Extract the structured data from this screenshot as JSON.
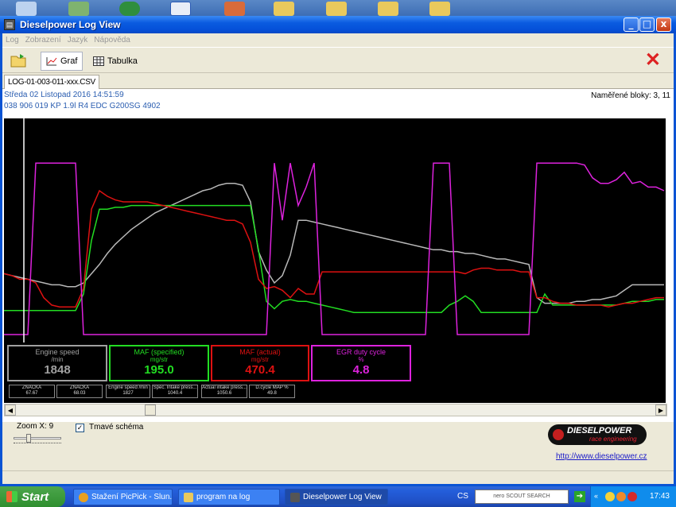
{
  "window": {
    "title": "Dieselpower Log View",
    "min": "_",
    "max": "□",
    "close": "x"
  },
  "menu": [
    "Log",
    "Zobrazení",
    "Jazyk",
    "Nápověda"
  ],
  "toolbar": {
    "graph_label": "Graf",
    "table_label": "Tabulka",
    "close_glyph": "✕"
  },
  "tab": {
    "file_name": "LOG-01-003-011-xxx.CSV"
  },
  "info": {
    "date": "Středa 02 Listopad 2016 14:51:59",
    "vehicle": "038 906 019 KP  1.9l R4 EDC G200SG  4902",
    "blocks": "Naměřené bloky: 3, 11"
  },
  "gauges": [
    {
      "label": "Engine speed",
      "unit": "/min",
      "value": "1848",
      "color": "#a0a0a0"
    },
    {
      "label": "MAF (specified)",
      "unit": "mg/str",
      "value": "195.0",
      "color": "#22dd22"
    },
    {
      "label": "MAF (actual)",
      "unit": "mg/str",
      "value": "470.4",
      "color": "#dd1111"
    },
    {
      "label": "EGR duty cycle",
      "unit": "%",
      "value": "4.8",
      "color": "#dd22dd"
    }
  ],
  "minis": [
    {
      "label": "ZNAČKA",
      "value": "67.67"
    },
    {
      "label": "ZNAČKA",
      "value": "68.03"
    },
    {
      "label": "Engine speed /min",
      "value": "1827"
    },
    {
      "label": "Spec. Intake press...",
      "value": "1040.4"
    },
    {
      "label": "Actual intake press...",
      "value": "1050.6"
    },
    {
      "label": "D.cycle MAP %",
      "value": "49.8"
    }
  ],
  "controls": {
    "zoom_label": "Zoom X: 9",
    "zoom_level": 9,
    "dark_scheme_label": "Tmavé schéma",
    "dark_scheme_checked": true,
    "dark_scheme_glyph": "✓"
  },
  "brand": {
    "name": "DIESELPOWER",
    "tagline": "race engineering",
    "url": "http://www.dieselpower.cz"
  },
  "taskbar": {
    "start": "Start",
    "tasks": [
      "Stažení PicPick - Slun...",
      "program na log",
      "Dieselpower Log View"
    ],
    "lang": "CS",
    "nero": "nero SCOUT SEARCH",
    "clock": "17:43"
  },
  "chart_data": {
    "type": "line",
    "x": [
      0,
      10,
      20,
      30,
      40,
      50,
      60,
      70,
      80,
      90,
      100,
      110,
      120,
      130,
      140,
      150,
      160,
      170,
      180,
      190,
      200,
      210,
      220,
      230,
      240,
      250,
      260,
      270,
      280,
      290,
      300,
      310,
      320,
      330,
      340,
      350,
      360,
      370,
      380,
      390,
      400,
      410,
      420,
      430,
      440,
      450,
      460,
      470,
      480,
      490,
      500,
      510,
      520,
      530,
      540,
      550,
      560,
      570,
      580,
      590,
      600,
      610,
      620,
      630,
      640,
      650,
      660,
      670,
      680,
      690,
      700,
      710,
      720,
      730,
      740,
      750,
      760,
      770,
      780,
      790,
      800,
      810,
      820,
      830
    ],
    "series": [
      {
        "color": "#b8b8b8",
        "values": [
          0.33,
          0.32,
          0.31,
          0.3,
          0.29,
          0.28,
          0.27,
          0.27,
          0.26,
          0.26,
          0.28,
          0.33,
          0.38,
          0.44,
          0.49,
          0.53,
          0.57,
          0.6,
          0.63,
          0.66,
          0.68,
          0.7,
          0.72,
          0.74,
          0.76,
          0.78,
          0.79,
          0.81,
          0.82,
          0.82,
          0.81,
          0.72,
          0.45,
          0.35,
          0.28,
          0.32,
          0.43,
          0.62,
          0.62,
          0.61,
          0.6,
          0.59,
          0.58,
          0.57,
          0.56,
          0.55,
          0.54,
          0.53,
          0.52,
          0.51,
          0.5,
          0.49,
          0.48,
          0.47,
          0.46,
          0.46,
          0.45,
          0.45,
          0.44,
          0.44,
          0.43,
          0.42,
          0.41,
          0.41,
          0.4,
          0.39,
          0.38,
          0.2,
          0.17,
          0.17,
          0.17,
          0.17,
          0.18,
          0.18,
          0.19,
          0.19,
          0.2,
          0.21,
          0.24,
          0.27,
          0.27,
          0.27,
          0.27,
          0.27
        ]
      },
      {
        "color": "#22dd22",
        "values": [
          0.13,
          0.13,
          0.13,
          0.13,
          0.13,
          0.13,
          0.13,
          0.13,
          0.13,
          0.13,
          0.22,
          0.51,
          0.68,
          0.68,
          0.69,
          0.69,
          0.7,
          0.7,
          0.7,
          0.7,
          0.7,
          0.7,
          0.7,
          0.7,
          0.7,
          0.7,
          0.7,
          0.7,
          0.7,
          0.7,
          0.7,
          0.7,
          0.46,
          0.18,
          0.14,
          0.18,
          0.19,
          0.18,
          0.18,
          0.17,
          0.16,
          0.15,
          0.14,
          0.13,
          0.12,
          0.12,
          0.12,
          0.12,
          0.12,
          0.12,
          0.12,
          0.12,
          0.12,
          0.12,
          0.12,
          0.12,
          0.16,
          0.18,
          0.21,
          0.18,
          0.12,
          0.12,
          0.12,
          0.12,
          0.12,
          0.12,
          0.12,
          0.12,
          0.22,
          0.16,
          0.16,
          0.16,
          0.16,
          0.16,
          0.16,
          0.16,
          0.16,
          0.16,
          0.17,
          0.18,
          0.18,
          0.18,
          0.19,
          0.19
        ]
      },
      {
        "color": "#dd1111",
        "values": [
          0.33,
          0.32,
          0.3,
          0.3,
          0.28,
          0.2,
          0.16,
          0.15,
          0.15,
          0.15,
          0.25,
          0.68,
          0.78,
          0.75,
          0.73,
          0.72,
          0.72,
          0.72,
          0.72,
          0.71,
          0.7,
          0.69,
          0.68,
          0.67,
          0.66,
          0.65,
          0.64,
          0.63,
          0.62,
          0.62,
          0.6,
          0.5,
          0.3,
          0.25,
          0.26,
          0.24,
          0.2,
          0.25,
          0.22,
          0.22,
          0.34,
          0.34,
          0.34,
          0.34,
          0.34,
          0.34,
          0.34,
          0.34,
          0.34,
          0.34,
          0.34,
          0.34,
          0.34,
          0.34,
          0.34,
          0.34,
          0.34,
          0.34,
          0.33,
          0.35,
          0.36,
          0.36,
          0.35,
          0.35,
          0.35,
          0.34,
          0.34,
          0.2,
          0.2,
          0.18,
          0.17,
          0.17,
          0.16,
          0.16,
          0.16,
          0.16,
          0.15,
          0.16,
          0.17,
          0.17,
          0.18,
          0.19,
          0.2,
          0.2
        ]
      },
      {
        "color": "#dd22dd",
        "values": [
          0.0,
          0.0,
          0.0,
          0.0,
          0.93,
          0.93,
          0.93,
          0.93,
          0.93,
          0.93,
          0.0,
          0.0,
          0.0,
          0.0,
          0.0,
          0.0,
          0.0,
          0.0,
          0.0,
          0.0,
          0.0,
          0.0,
          0.0,
          0.0,
          0.0,
          0.0,
          0.0,
          0.0,
          0.0,
          0.0,
          0.0,
          0.0,
          0.0,
          0.0,
          0.93,
          0.62,
          0.93,
          0.7,
          0.8,
          0.93,
          0.0,
          0.0,
          0.0,
          0.0,
          0.0,
          0.0,
          0.0,
          0.0,
          0.0,
          0.0,
          0.0,
          0.0,
          0.0,
          0.0,
          0.93,
          0.93,
          0.93,
          0.0,
          0.0,
          0.0,
          0.0,
          0.0,
          0.0,
          0.0,
          0.0,
          0.0,
          0.0,
          0.93,
          0.93,
          0.93,
          0.93,
          0.93,
          0.93,
          0.92,
          0.85,
          0.82,
          0.82,
          0.84,
          0.88,
          0.82,
          0.83,
          0.8,
          0.8,
          0.78
        ]
      }
    ],
    "ylim": [
      0,
      1
    ],
    "grid": false,
    "cursor_x": 25
  }
}
